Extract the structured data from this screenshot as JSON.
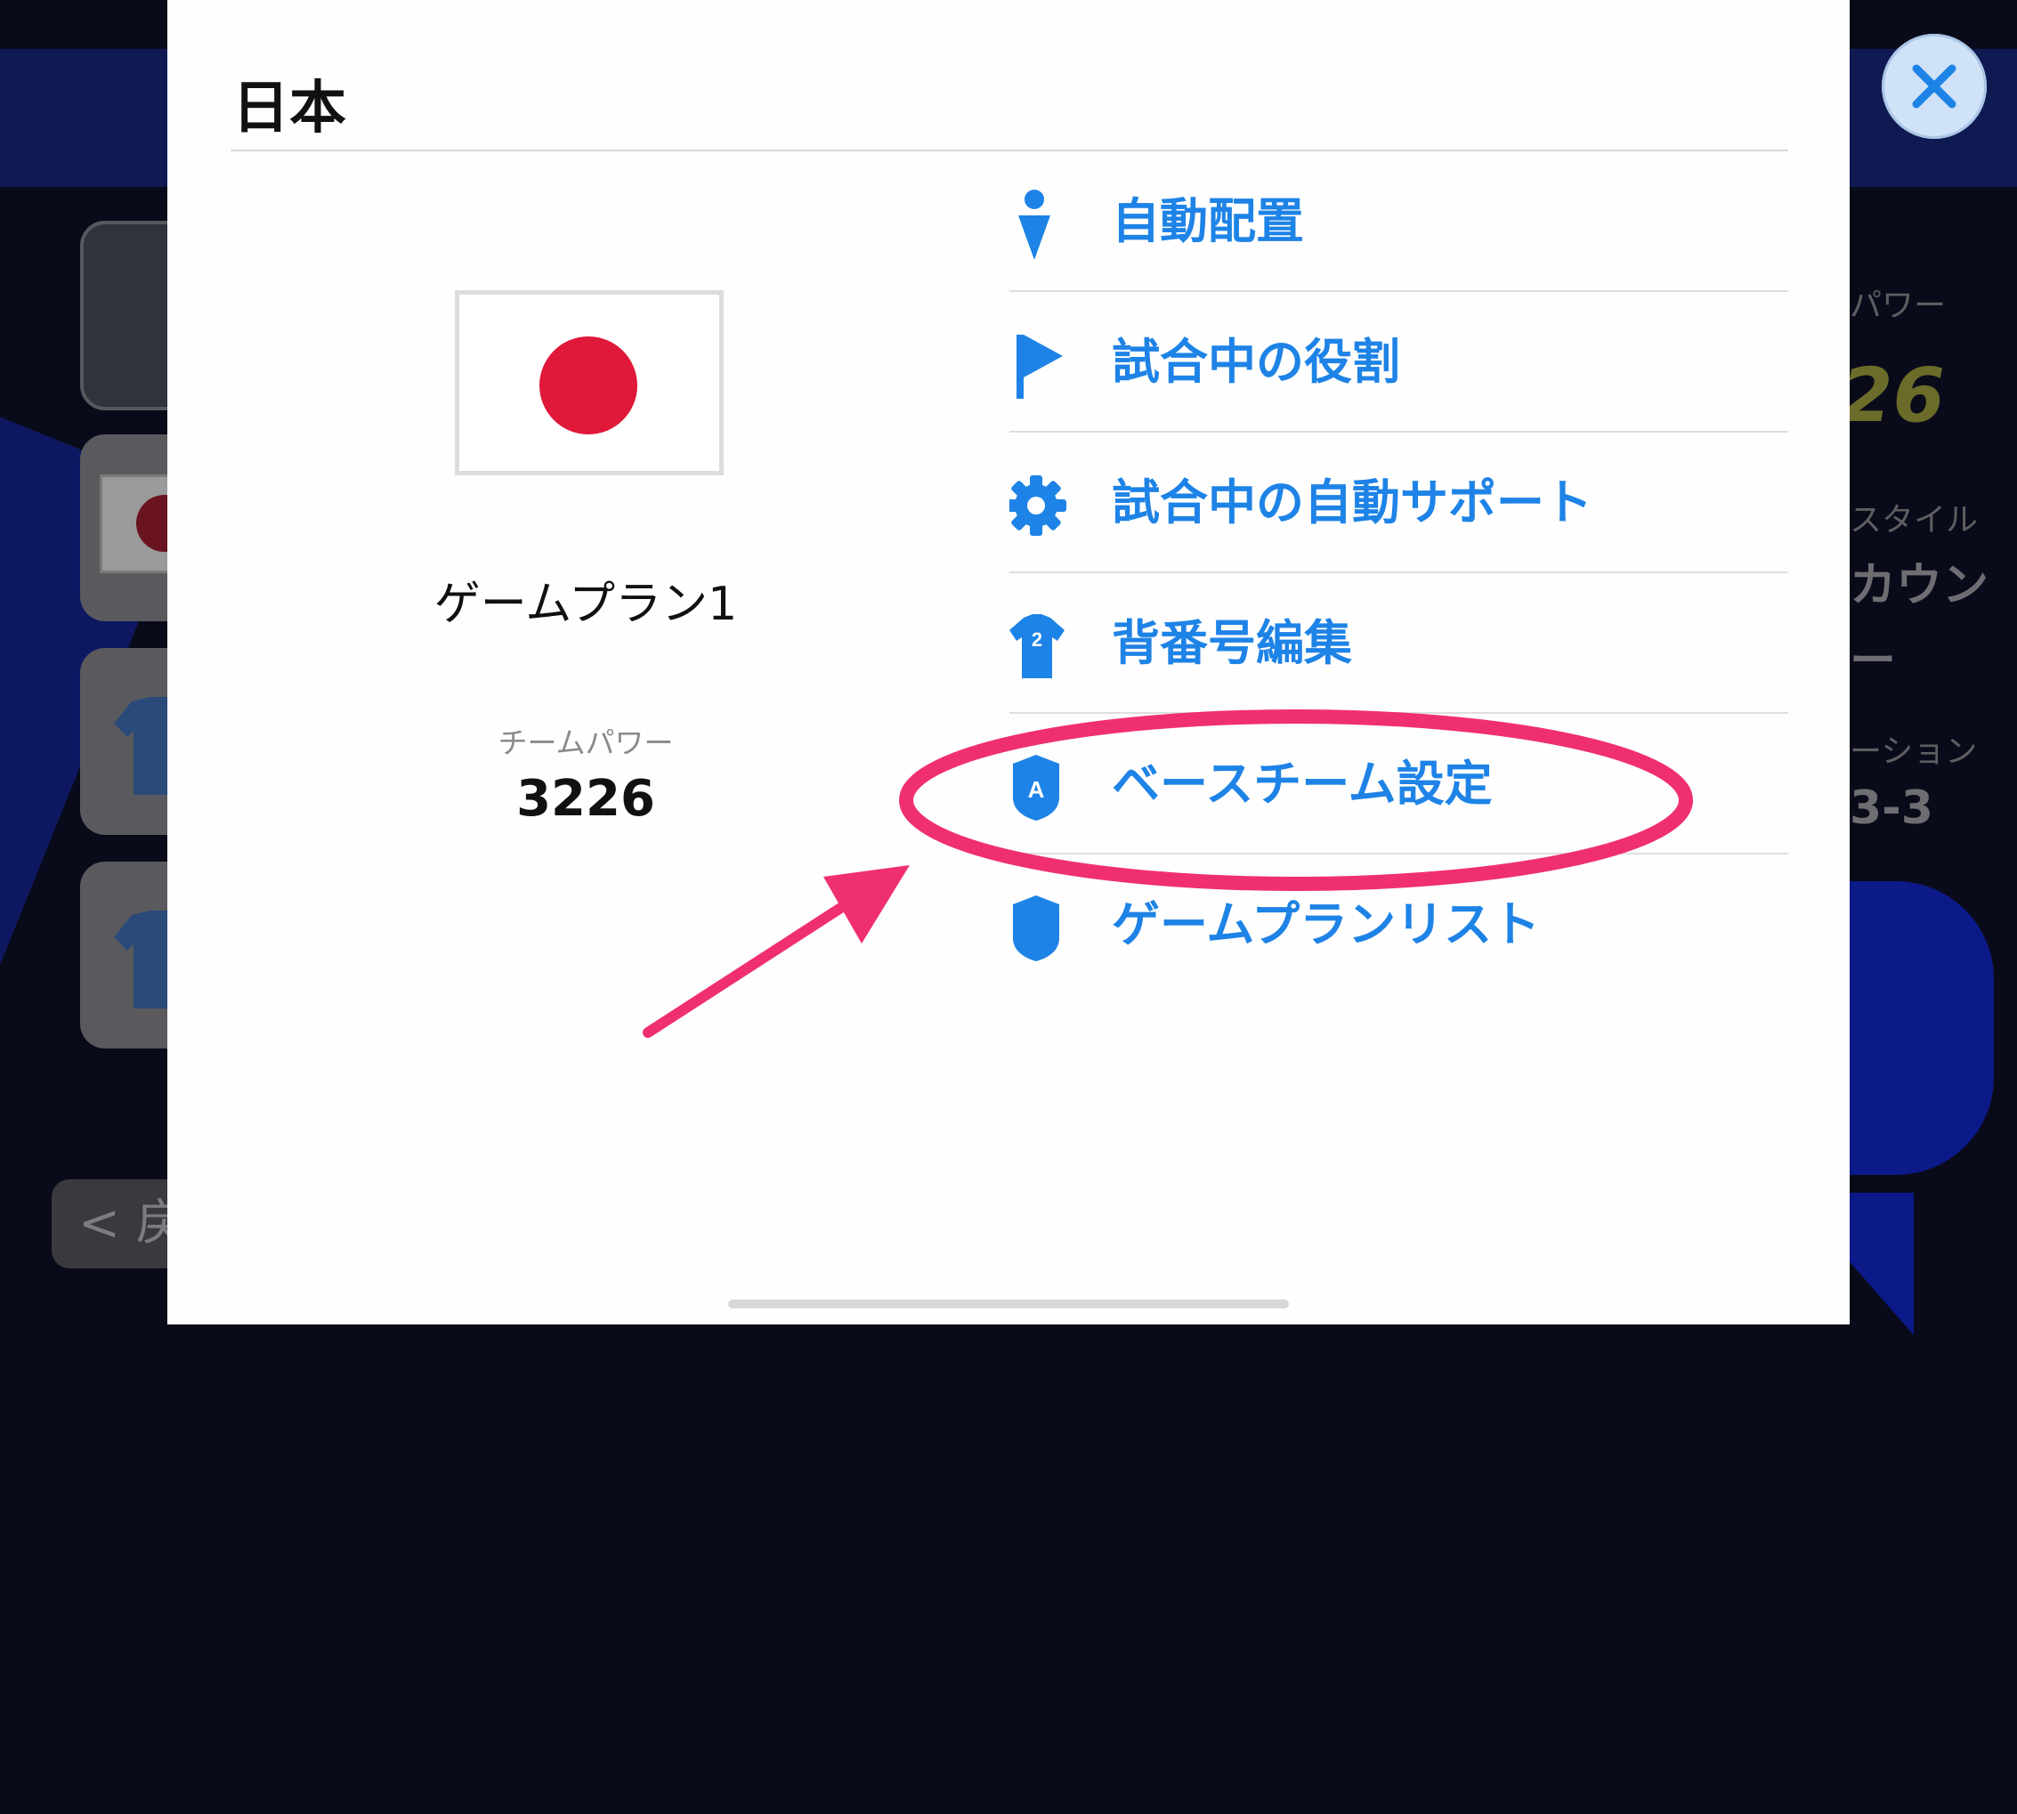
{
  "background": {
    "back_label": "< 戻",
    "right_label_power": "パワー",
    "right_value_power": "26",
    "right_label_style": "スタイル",
    "right_value_style": "カウン",
    "right_value_dash": "ー",
    "right_label_formation": "ーション",
    "right_value_formation": "3-3"
  },
  "modal": {
    "title": "日本",
    "plan_name": "ゲームプラン1",
    "team_power_label": "チームパワー",
    "team_power_value": "3226",
    "menu": [
      {
        "label": "自動配置",
        "icon": "auto-placement-icon"
      },
      {
        "label": "試合中の役割",
        "icon": "flag-icon"
      },
      {
        "label": "試合中の自動サポート",
        "icon": "gear-icon"
      },
      {
        "label": "背番号編集",
        "icon": "jersey-number-icon"
      },
      {
        "label": "ベースチーム設定",
        "icon": "base-team-shield-icon"
      },
      {
        "label": "ゲームプランリスト",
        "icon": "shield-icon"
      }
    ]
  },
  "colors": {
    "accent_blue": "#1e83e6",
    "flag_red": "#e0183a",
    "annotation_pink": "#f0306e"
  }
}
